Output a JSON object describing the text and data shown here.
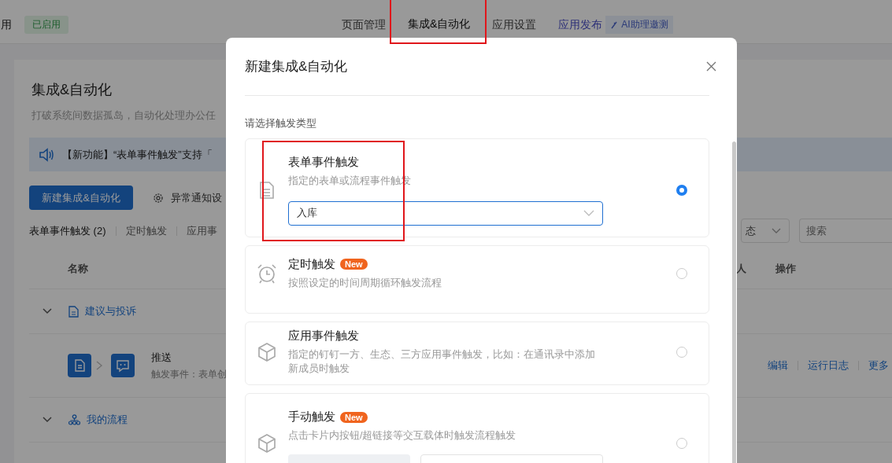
{
  "header": {
    "left_text": "用",
    "status_badge": "已启用",
    "nav": [
      {
        "label": "页面管理",
        "selected": false,
        "kind": "tab"
      },
      {
        "label": "集成&自动化",
        "selected": true,
        "kind": "tab"
      },
      {
        "label": "应用设置",
        "selected": false,
        "kind": "tab"
      },
      {
        "label": "应用发布",
        "selected": false,
        "kind": "link"
      }
    ],
    "ai_badge": "AI助理邀测"
  },
  "page": {
    "title": "集成&自动化",
    "description": "打破系统间数据孤岛，自动化处理办公任",
    "notice": "【新功能】“表单事件触发”支持「",
    "new_button": "新建集成&自动化",
    "settings_link": "异常通知设",
    "tabs": [
      {
        "label": "表单事件触发 (2)",
        "selected": true
      },
      {
        "label": "定时触发",
        "selected": false
      },
      {
        "label": "应用事",
        "selected": false
      }
    ],
    "status_filter": "态",
    "search": {
      "placeholder": "搜索"
    },
    "columns": [
      "名称",
      "人",
      "操作"
    ],
    "rows": [
      {
        "kind": "form_group",
        "name": "建议与投诉",
        "expanded": true
      },
      {
        "kind": "flow",
        "name": "推送",
        "detail": "触发事件：表单创",
        "actions": [
          "编辑",
          "运行日志",
          "更多"
        ]
      },
      {
        "kind": "process_group",
        "name": "我的流程",
        "expanded": true
      }
    ]
  },
  "modal": {
    "title": "新建集成&自动化",
    "label": "请选择触发类型",
    "options": [
      {
        "kind": "form",
        "title": "表单事件触发",
        "description": "指定的表单或流程事件触发",
        "selected": true,
        "select_value": "入库"
      },
      {
        "kind": "timer",
        "title": "定时触发",
        "badge": "New",
        "description": "按照设定的时间周期循环触发流程",
        "selected": false
      },
      {
        "kind": "app",
        "title": "应用事件触发",
        "description": "指定的钉钉一方、生态、三方应用事件触发，比如：在通讯录中添加新成员时触发",
        "selected": false
      },
      {
        "kind": "manual",
        "title": "手动触发",
        "badge": "New",
        "description": "点击卡片内按钮/超链接等交互载体时触发流程触发",
        "selected": false
      }
    ]
  }
}
